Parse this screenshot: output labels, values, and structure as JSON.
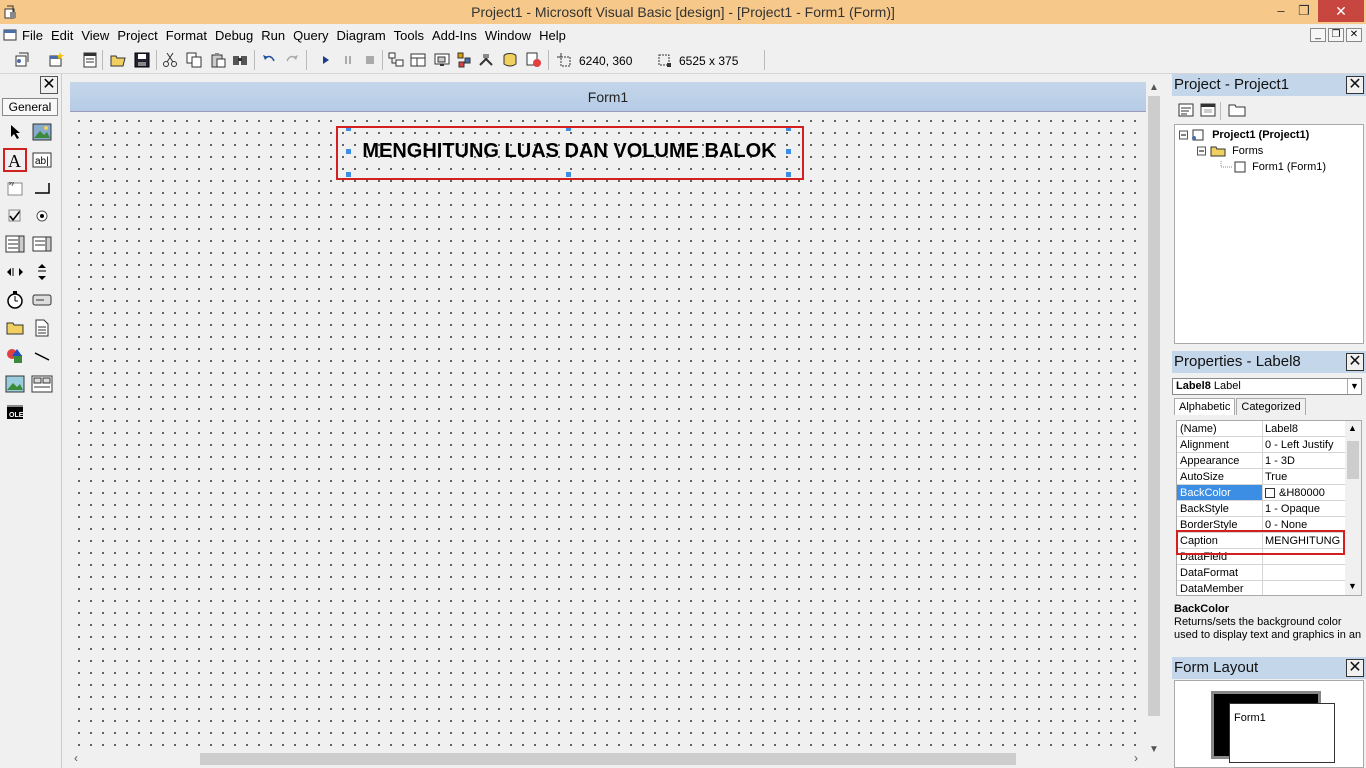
{
  "window": {
    "title": "Project1 - Microsoft Visual Basic [design] - [Project1 - Form1 (Form)]",
    "minimize": "–",
    "maximize": "❐",
    "close": "✕"
  },
  "menu": {
    "items": [
      "File",
      "Edit",
      "View",
      "Project",
      "Format",
      "Debug",
      "Run",
      "Query",
      "Diagram",
      "Tools",
      "Add-Ins",
      "Window",
      "Help"
    ],
    "mdi_buttons": [
      "_",
      "❐",
      "✕"
    ]
  },
  "toolbar": {
    "position": "6240, 360",
    "size": "6525 x 375"
  },
  "toolbox": {
    "tab_label": "General",
    "close": "✕",
    "tools": [
      "pointer",
      "picturebox",
      "label",
      "textbox",
      "frame",
      "commandbutton",
      "checkbox",
      "optionbutton",
      "combobox",
      "listbox",
      "hscrollbar",
      "vscrollbar",
      "timer",
      "drivelistbox",
      "dirlistbox",
      "filelistbox",
      "shape",
      "line",
      "image",
      "data",
      "ole"
    ],
    "highlighted_tool": "label"
  },
  "designer": {
    "form_caption": "Form1",
    "label_caption": "MENGHITUNG LUAS DAN VOLUME BALOK"
  },
  "project_panel": {
    "title": "Project - Project1",
    "close": "✕",
    "tree": {
      "project": "Project1 (Project1)",
      "folder": "Forms",
      "form": "Form1 (Form1)"
    }
  },
  "properties_panel": {
    "title": "Properties - Label8",
    "close": "✕",
    "object_name": "Label8",
    "object_type": "Label",
    "tabs": [
      "Alphabetic",
      "Categorized"
    ],
    "active_tab": "Alphabetic",
    "rows": [
      {
        "name": "(Name)",
        "value": "Label8"
      },
      {
        "name": "Alignment",
        "value": "0 - Left Justify"
      },
      {
        "name": "Appearance",
        "value": "1 - 3D"
      },
      {
        "name": "AutoSize",
        "value": "True"
      },
      {
        "name": "BackColor",
        "value": "&H80000"
      },
      {
        "name": "BackStyle",
        "value": "1 - Opaque"
      },
      {
        "name": "BorderStyle",
        "value": "0 - None"
      },
      {
        "name": "Caption",
        "value": "MENGHITUNG LU"
      },
      {
        "name": "DataField",
        "value": ""
      },
      {
        "name": "DataFormat",
        "value": ""
      },
      {
        "name": "DataMember",
        "value": ""
      }
    ],
    "selected_row": "BackColor",
    "highlighted_row": "Caption",
    "description_title": "BackColor",
    "description_text": "Returns/sets the background color used to display text and graphics in an"
  },
  "layout_panel": {
    "title": "Form Layout",
    "close": "✕",
    "mini_form_label": "Form1"
  },
  "colors": {
    "title_bar": "#f6c98b",
    "close_button": "#c7463f",
    "panel_header": "#c4d6ea",
    "highlight": "#d21f1f",
    "selection": "#3c8ee4"
  }
}
